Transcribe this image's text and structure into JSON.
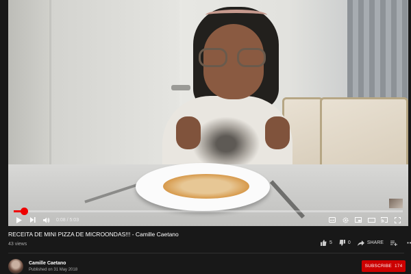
{
  "video": {
    "progress_fraction": 0.027,
    "time_current": "0:08",
    "time_total": "5:03"
  },
  "info": {
    "title": "RECEITA DE MINI PIZZA DE MICROONDAS!!! - Camille Caetano",
    "views": "43 views",
    "likes": "5",
    "dislikes": "0",
    "share_label": "SHARE"
  },
  "channel": {
    "name": "Camille Caetano",
    "published": "Published on 31 May 2018",
    "subscribe_label": "SUBSCRIBE",
    "subscriber_count": "174"
  },
  "colors": {
    "accent": "#cc0000",
    "background": "#181818"
  }
}
